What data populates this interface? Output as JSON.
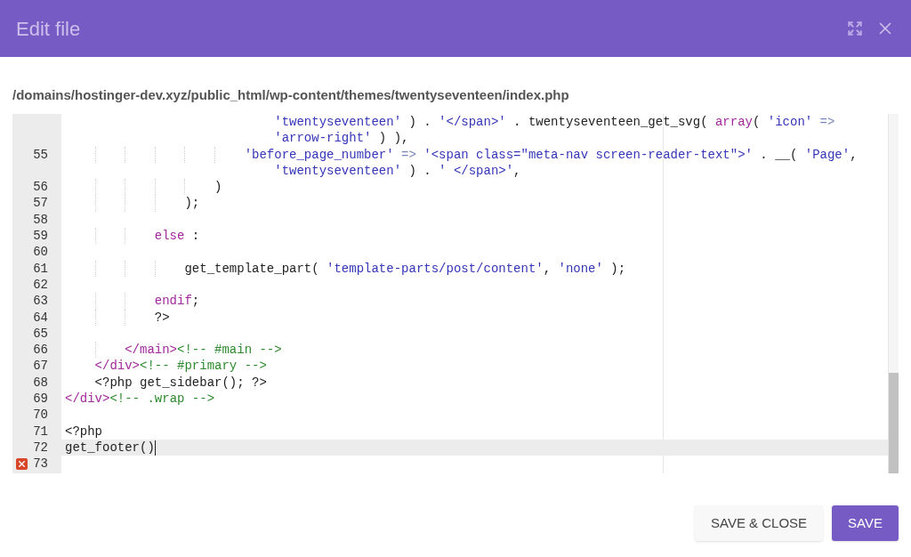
{
  "dialog": {
    "title": "Edit file"
  },
  "file_path": "/domains/hostinger-dev.xyz/public_html/wp-content/themes/twentyseventeen/index.php",
  "editor": {
    "lines": [
      {
        "active": false,
        "error": false,
        "tokens": [
          {
            "t": "                            'twentyseventeen'",
            "kind": "string"
          },
          {
            "t": " ) . ",
            "kind": "plain"
          },
          {
            "t": "'</span>'",
            "kind": "string"
          },
          {
            "t": " . twentyseventeen_get_svg( ",
            "kind": "plain"
          },
          {
            "t": "array",
            "kind": "keyword"
          },
          {
            "t": "( ",
            "kind": "plain"
          },
          {
            "t": "'icon'",
            "kind": "string"
          },
          {
            "t": " =>",
            "kind": "operator"
          }
        ]
      },
      {
        "active": false,
        "error": false,
        "tokens": [
          {
            "t": "                            'arrow-right'",
            "kind": "string"
          },
          {
            "t": " ) ),",
            "kind": "plain"
          }
        ]
      },
      {
        "number": "55",
        "active": false,
        "error": false,
        "tokens": [
          {
            "t": "                        'before_page_number'",
            "kind": "string"
          },
          {
            "t": " => ",
            "kind": "operator"
          },
          {
            "t": "'<span class=\"meta-nav screen-reader-text\">'",
            "kind": "string"
          },
          {
            "t": " . __( ",
            "kind": "plain"
          },
          {
            "t": "'Page'",
            "kind": "string"
          },
          {
            "t": ",",
            "kind": "plain"
          }
        ]
      },
      {
        "active": false,
        "error": false,
        "tokens": [
          {
            "t": "                            'twentyseventeen'",
            "kind": "string"
          },
          {
            "t": " ) . ",
            "kind": "plain"
          },
          {
            "t": "' </span>'",
            "kind": "string"
          },
          {
            "t": ",",
            "kind": "plain"
          }
        ]
      },
      {
        "number": "56",
        "active": false,
        "error": false,
        "tokens": [
          {
            "t": "                    )",
            "kind": "plain"
          }
        ]
      },
      {
        "number": "57",
        "active": false,
        "error": false,
        "tokens": [
          {
            "t": "                );",
            "kind": "plain"
          }
        ]
      },
      {
        "number": "58",
        "active": false,
        "error": false
      },
      {
        "number": "59",
        "active": false,
        "error": false,
        "tokens": [
          {
            "t": "            else",
            "kind": "keyword"
          },
          {
            "t": " :",
            "kind": "plain"
          }
        ]
      },
      {
        "number": "60",
        "active": false,
        "error": false
      },
      {
        "number": "61",
        "active": false,
        "error": false,
        "tokens": [
          {
            "t": "                get_template_part( ",
            "kind": "plain"
          },
          {
            "t": "'template-parts/post/content'",
            "kind": "string"
          },
          {
            "t": ", ",
            "kind": "plain"
          },
          {
            "t": "'none'",
            "kind": "string"
          },
          {
            "t": " );",
            "kind": "plain"
          }
        ]
      },
      {
        "number": "62",
        "active": false,
        "error": false
      },
      {
        "number": "63",
        "active": false,
        "error": false,
        "tokens": [
          {
            "t": "            endif",
            "kind": "keyword"
          },
          {
            "t": ";",
            "kind": "plain"
          }
        ]
      },
      {
        "number": "64",
        "active": false,
        "error": false,
        "tokens": [
          {
            "t": "            ?>",
            "kind": "plain"
          }
        ]
      },
      {
        "number": "65",
        "active": false,
        "error": false
      },
      {
        "number": "66",
        "active": false,
        "error": false,
        "tokens": [
          {
            "t": "        </main>",
            "kind": "tag"
          },
          {
            "t": "<!-- #main -->",
            "kind": "comment"
          }
        ]
      },
      {
        "number": "67",
        "active": false,
        "error": false,
        "tokens": [
          {
            "t": "    </div>",
            "kind": "tag"
          },
          {
            "t": "<!-- #primary -->",
            "kind": "comment"
          }
        ]
      },
      {
        "number": "68",
        "active": false,
        "error": false,
        "tokens": [
          {
            "t": "    <?php get_sidebar(); ?>",
            "kind": "plain"
          }
        ]
      },
      {
        "number": "69",
        "active": false,
        "error": false,
        "tokens": [
          {
            "t": "</div>",
            "kind": "tag"
          },
          {
            "t": "<!-- .wrap -->",
            "kind": "comment"
          }
        ]
      },
      {
        "number": "70",
        "active": false,
        "error": false
      },
      {
        "number": "71",
        "active": false,
        "error": false,
        "tokens": [
          {
            "t": "<?php",
            "kind": "plain"
          }
        ]
      },
      {
        "number": "72",
        "active": true,
        "error": false,
        "tokens": [
          {
            "t": "get_footer()",
            "kind": "plain"
          }
        ]
      },
      {
        "number": "73",
        "active": false,
        "error": true
      }
    ]
  },
  "buttons": [
    {
      "label": "SAVE & CLOSE",
      "kind": "secondary"
    },
    {
      "label": "SAVE",
      "kind": "primary"
    }
  ]
}
